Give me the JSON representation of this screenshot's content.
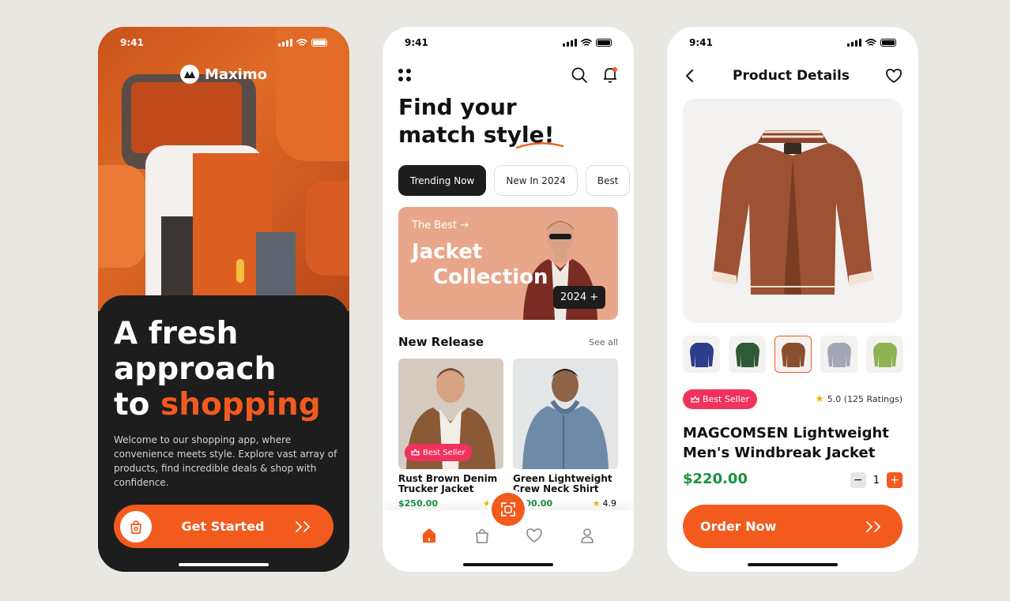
{
  "colors": {
    "accent": "#f25a1e",
    "dark": "#1d1d1d",
    "price": "#14923c",
    "badge": "#f0325e",
    "star": "#f4b400"
  },
  "status": {
    "time": "9:41"
  },
  "onboarding": {
    "brand": "Maximo",
    "headline_line1": "A fresh",
    "headline_line2": "approach",
    "headline_line3a": "to ",
    "headline_line3b": "shopping",
    "welcome": "Welcome to our shopping app, where convenience meets style. Explore vast array of products, find incredible deals & shop with confidence.",
    "cta": "Get Started",
    "cta_icon": "shopping-bag-icon"
  },
  "home": {
    "title_line1": "Find your",
    "title_line2": "match style!",
    "chips": [
      "Trending Now",
      "New In 2024",
      "Best"
    ],
    "banner": {
      "small": "The Best →",
      "line1": "Jacket",
      "line2": "Collection",
      "badge": "2024 +"
    },
    "section_title": "New Release",
    "see_all": "See all",
    "products": [
      {
        "name_line1": "Rust Brown Denim",
        "name_line2": "Trucker Jacket",
        "price": "$250.00",
        "rating": "5",
        "badge": "Best Seller"
      },
      {
        "name_line1": "Green Lightweight",
        "name_line2": "Crew Neck Shirt",
        "price": "$200.00",
        "rating": "4.9"
      }
    ],
    "tabs": [
      "home-icon",
      "bag-icon",
      "heart-icon",
      "profile-icon"
    ]
  },
  "details": {
    "title": "Product Details",
    "thumb_colors": [
      "#2d3d8c",
      "#2f5a34",
      "#8c4f2e",
      "#a3a7b6",
      "#8fb352"
    ],
    "selected_thumb": 2,
    "badge": "Best Seller",
    "rating": "5.0 (125 Ratings)",
    "name_line1": "MAGCOMSEN Lightweight",
    "name_line2": "Men's Windbreak Jacket",
    "price": "$220.00",
    "qty": "1",
    "qty_minus": "−",
    "qty_plus": "+",
    "cta": "Order Now"
  }
}
